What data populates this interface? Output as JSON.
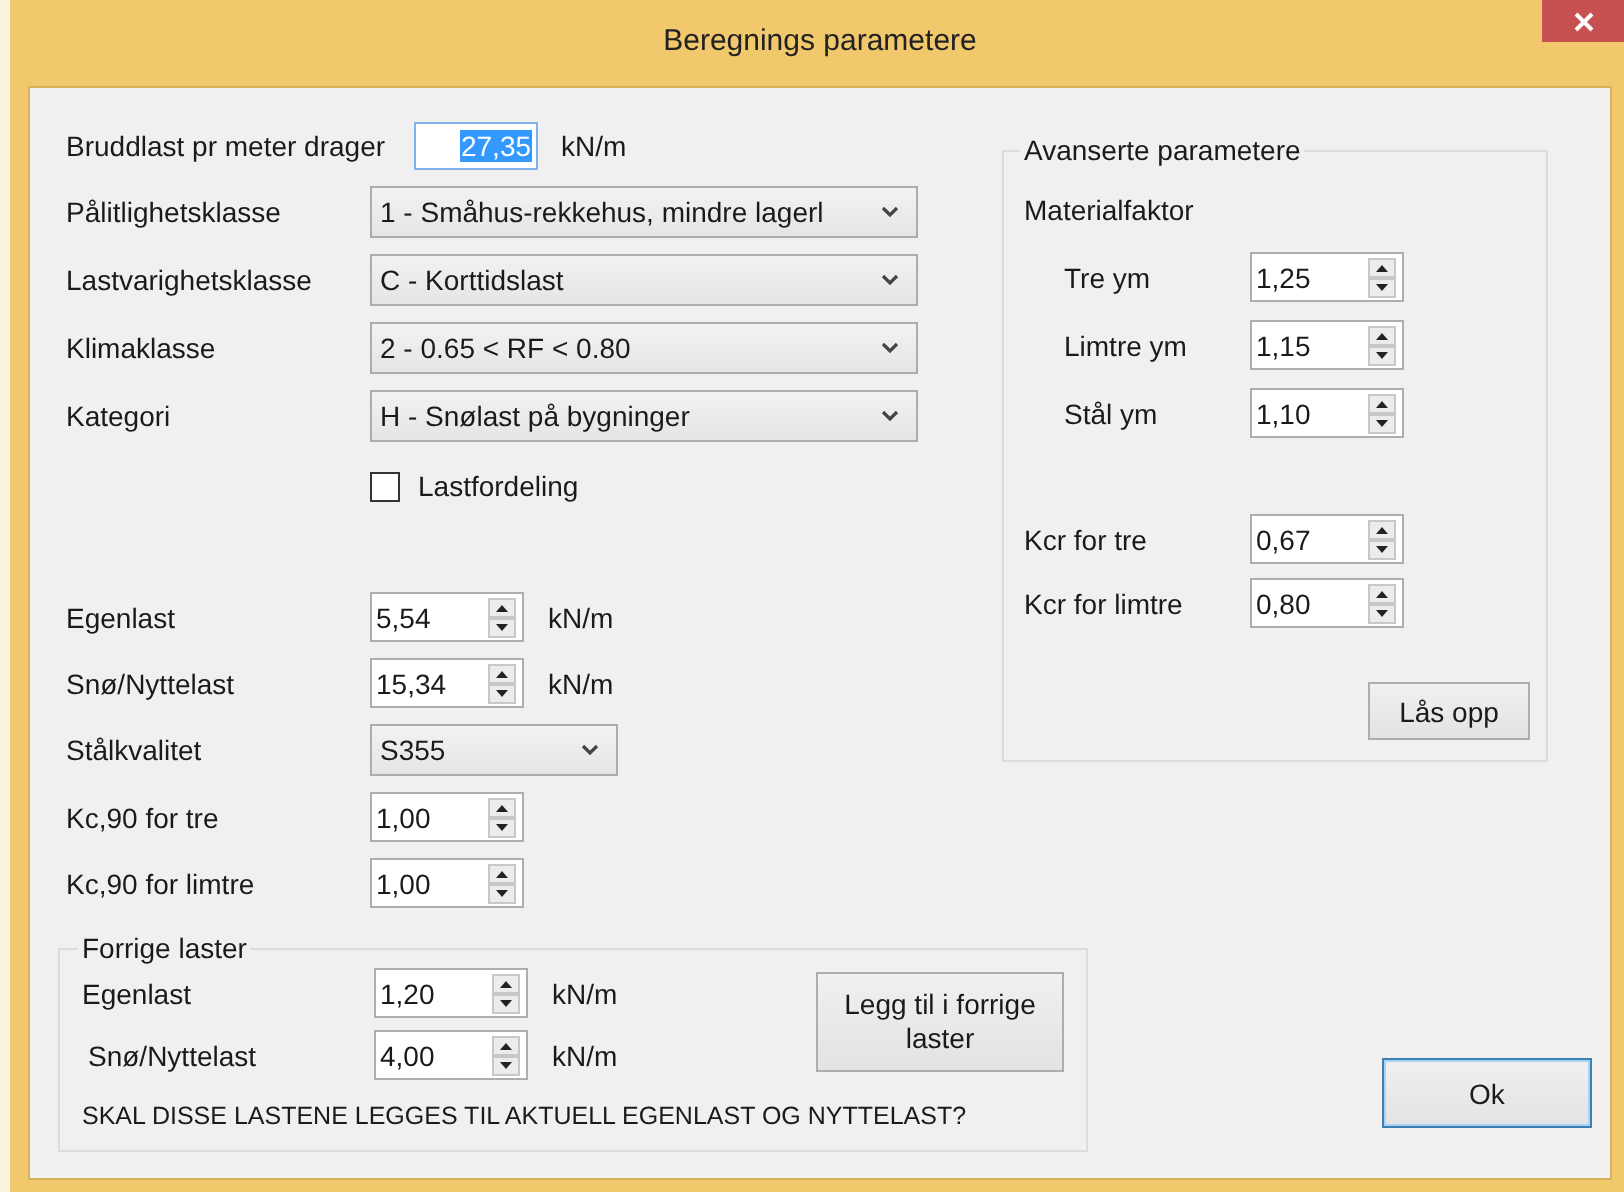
{
  "window": {
    "title": "Beregnings parametere"
  },
  "load_settings": [
    {
      "kind": "text",
      "label": "Bruddlast pr meter drager",
      "value": "27,35",
      "unit": "kN/m",
      "text_selected": true
    },
    {
      "kind": "dropdown",
      "label": "Pålitlighetsklasse",
      "value": "1 - Småhus-rekkehus, mindre lagerl"
    },
    {
      "kind": "dropdown",
      "label": "Lastvarighetsklasse",
      "value": "C - Korttidslast"
    },
    {
      "kind": "dropdown",
      "label": "Klimaklasse",
      "value": "2 - 0.65 < RF < 0.80"
    },
    {
      "kind": "dropdown",
      "label": "Kategori",
      "value": "H - Snølast på bygninger"
    },
    {
      "kind": "checkbox",
      "label": "Lastfordeling",
      "checked": false
    }
  ],
  "load_values": [
    {
      "kind": "spin",
      "label": "Egenlast",
      "value": "5,54",
      "unit": "kN/m"
    },
    {
      "kind": "spin",
      "label": "Snø/Nyttelast",
      "value": "15,34",
      "unit": "kN/m"
    },
    {
      "kind": "dropdown",
      "label": "Stålkvalitet",
      "value": "S355"
    },
    {
      "kind": "spin",
      "label": "Kc,90 for tre",
      "value": "1,00"
    },
    {
      "kind": "spin",
      "label": "Kc,90 for limtre",
      "value": "1,00"
    }
  ],
  "advanced": {
    "title": "Avanserte parametere",
    "material_heading": "Materialfaktor",
    "material_factors": [
      {
        "label": "Tre  ym",
        "value": "1,25"
      },
      {
        "label": "Limtre  ym",
        "value": "1,15"
      },
      {
        "label": "Stål  ym",
        "value": "1,10"
      }
    ],
    "kcr_fields": [
      {
        "label": "Kcr for tre",
        "value": "0,67"
      },
      {
        "label": "Kcr for limtre",
        "value": "0,80"
      }
    ],
    "unlock_button": "Lås opp"
  },
  "previous_loads": {
    "title": "Forrige laster",
    "fields": [
      {
        "label": "Egenlast",
        "value": "1,20",
        "unit": "kN/m"
      },
      {
        "label": "Snø/Nyttelast",
        "value": "4,00",
        "unit": "kN/m"
      }
    ],
    "add_button": "Legg til i forrige laster",
    "question": "SKAL DISSE LASTENE LEGGES TIL AKTUELL EGENLAST OG NYTTELAST?"
  },
  "ok_button": {
    "label": "Ok",
    "default": true
  }
}
